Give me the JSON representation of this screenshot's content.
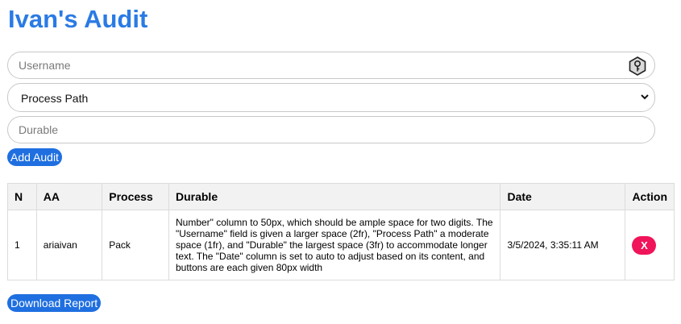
{
  "header": {
    "title": "Ivan's Audit"
  },
  "form": {
    "username_placeholder": "Username",
    "process_selected": "Process Path",
    "durable_placeholder": "Durable",
    "add_button": "Add Audit"
  },
  "table": {
    "columns": [
      "N",
      "AA",
      "Process",
      "Durable",
      "Date",
      "Action"
    ],
    "rows": [
      {
        "n": "1",
        "aa": "ariaivan",
        "process": "Pack",
        "durable": "Number\" column to 50px, which should be ample space for two digits. The \"Username\" field is given a larger space (2fr), \"Process Path\" a moderate space (1fr), and \"Durable\" the largest space (3fr) to accommodate longer text. The \"Date\" column is set to auto to adjust based on its content, and buttons are each given 80px width",
        "date": "3/5/2024, 3:35:11 AM",
        "action": "X"
      }
    ]
  },
  "footer": {
    "download_button": "Download Report"
  },
  "colors": {
    "accent": "#2a7be4",
    "button": "#1f6fe0",
    "delete": "#f0145a"
  },
  "icons": {
    "username_field": "key-icon",
    "process_select": "chevron-down-icon"
  }
}
